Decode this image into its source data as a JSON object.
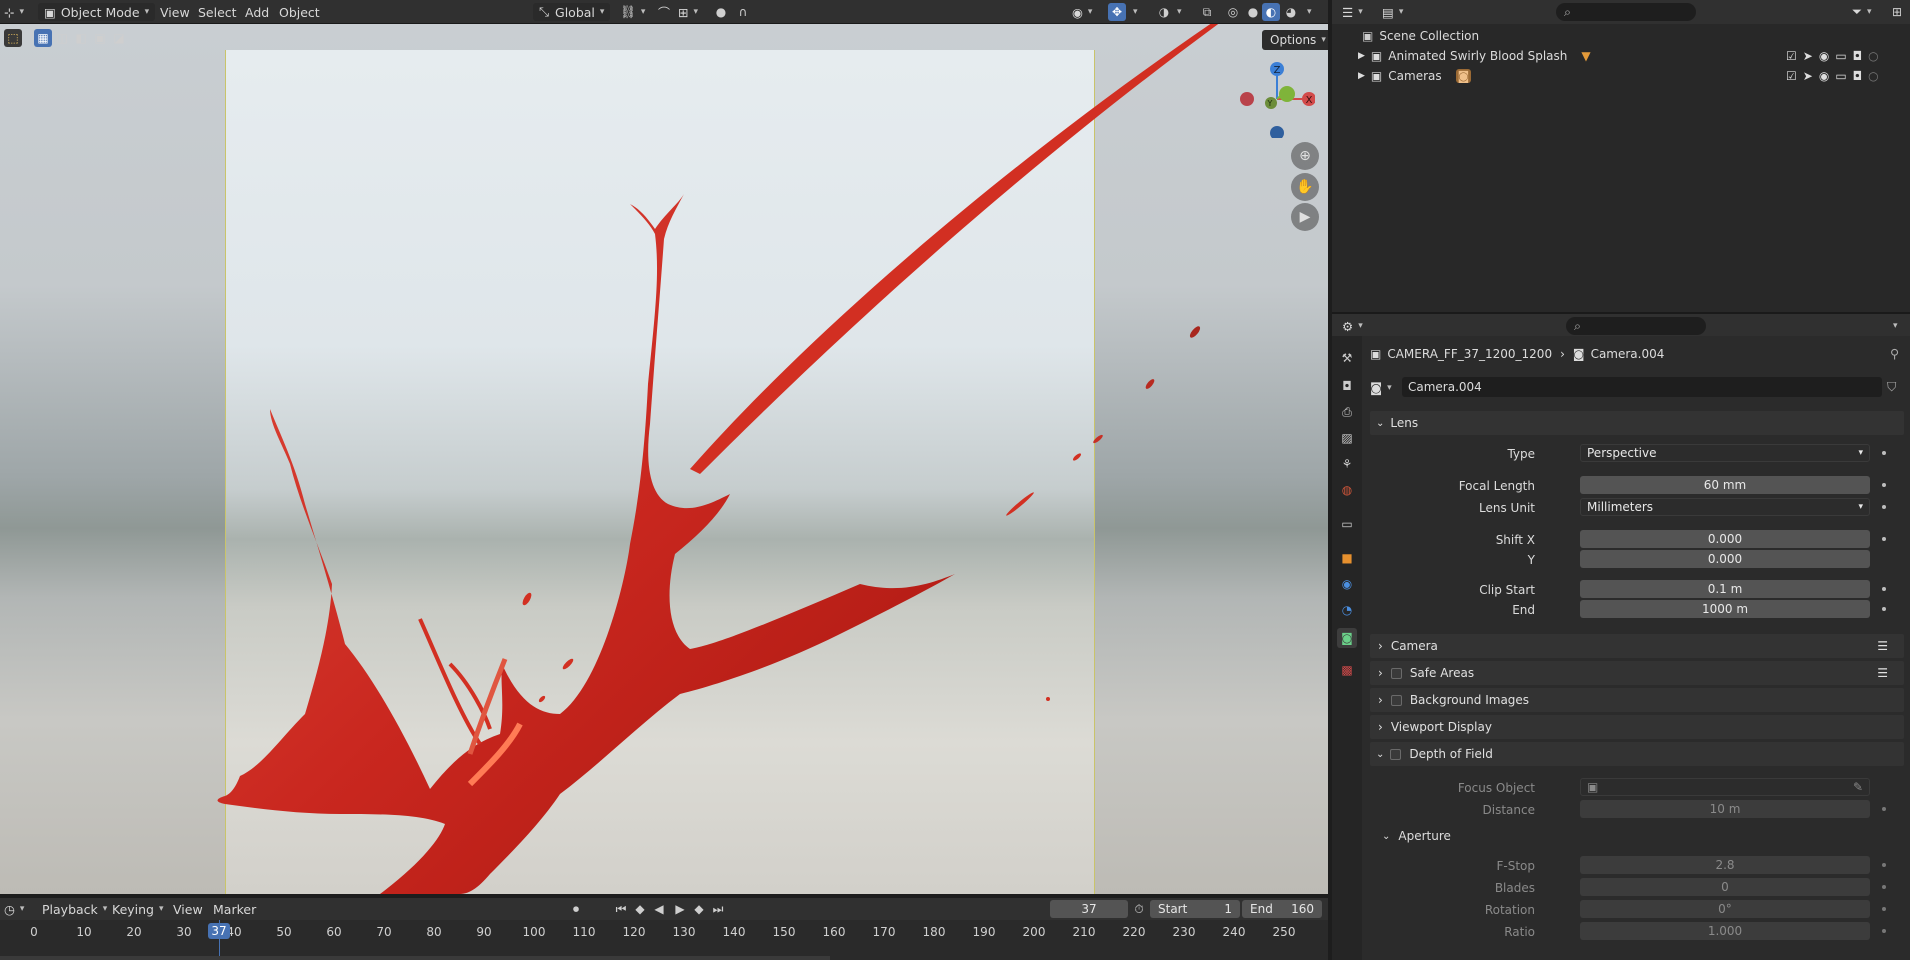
{
  "header": {
    "editor_icon": "3d-viewport-icon",
    "mode": "Object Mode",
    "menus": [
      "View",
      "Select",
      "Add",
      "Object"
    ],
    "transform_orientation": "Global"
  },
  "viewport": {
    "options_label": "Options",
    "gizmo": {
      "z": "Z",
      "x": "X",
      "y": "Y"
    }
  },
  "timeline": {
    "menus": [
      "Playback",
      "Keying",
      "View",
      "Marker"
    ],
    "current_frame": "37",
    "start_label": "Start",
    "start_value": "1",
    "end_label": "End",
    "end_value": "160",
    "ruler": [
      "0",
      "10",
      "20",
      "30",
      "40",
      "50",
      "60",
      "70",
      "80",
      "90",
      "100",
      "110",
      "120",
      "130",
      "140",
      "150",
      "160",
      "170",
      "180",
      "190",
      "200",
      "210",
      "220",
      "230",
      "240",
      "250"
    ],
    "playhead": "37"
  },
  "outliner": {
    "root": "Scene Collection",
    "items": [
      {
        "label": "Animated Swirly Blood Splash"
      },
      {
        "label": "Cameras"
      }
    ]
  },
  "properties": {
    "breadcrumb_object": "CAMERA_FF_37_1200_1200",
    "breadcrumb_data": "Camera.004",
    "datablock_name": "Camera.004",
    "lens": {
      "title": "Lens",
      "type_label": "Type",
      "type_value": "Perspective",
      "focal_label": "Focal Length",
      "focal_value": "60 mm",
      "unit_label": "Lens Unit",
      "unit_value": "Millimeters",
      "shiftx_label": "Shift X",
      "shiftx_value": "0.000",
      "shifty_label": "Y",
      "shifty_value": "0.000",
      "clipstart_label": "Clip Start",
      "clipstart_value": "0.1 m",
      "clipend_label": "End",
      "clipend_value": "1000 m"
    },
    "sections": {
      "camera": "Camera",
      "safe_areas": "Safe Areas",
      "background_images": "Background Images",
      "viewport_display": "Viewport Display",
      "dof": "Depth of Field"
    },
    "dof": {
      "focus_label": "Focus Object",
      "distance_label": "Distance",
      "distance_value": "10 m",
      "aperture_title": "Aperture",
      "fstop_label": "F-Stop",
      "fstop_value": "2.8",
      "blades_label": "Blades",
      "blades_value": "0",
      "rotation_label": "Rotation",
      "rotation_value": "0°",
      "ratio_label": "Ratio",
      "ratio_value": "1.000"
    }
  }
}
